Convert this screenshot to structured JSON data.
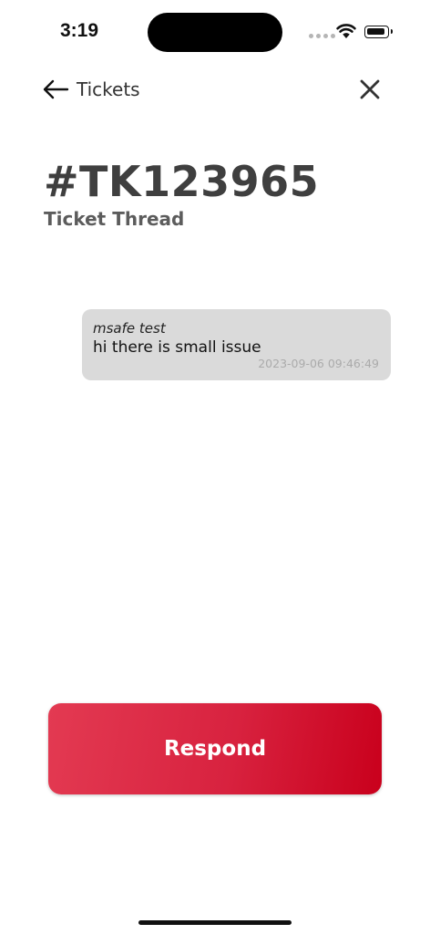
{
  "status_bar": {
    "time": "3:19"
  },
  "nav": {
    "back_label": "Tickets",
    "back_icon": "back-arrow-icon",
    "close_icon": "close-icon"
  },
  "ticket": {
    "id": "#TK123965",
    "subtitle": "Ticket Thread"
  },
  "messages": [
    {
      "author": "msafe test",
      "text": "hi there is small issue",
      "timestamp": "2023-09-06 09:46:49"
    }
  ],
  "actions": {
    "respond_label": "Respond"
  },
  "colors": {
    "accent_start": "#e33a52",
    "accent_end": "#c9001c",
    "bubble_bg": "#dadada",
    "title_text": "#3f3f3f"
  }
}
